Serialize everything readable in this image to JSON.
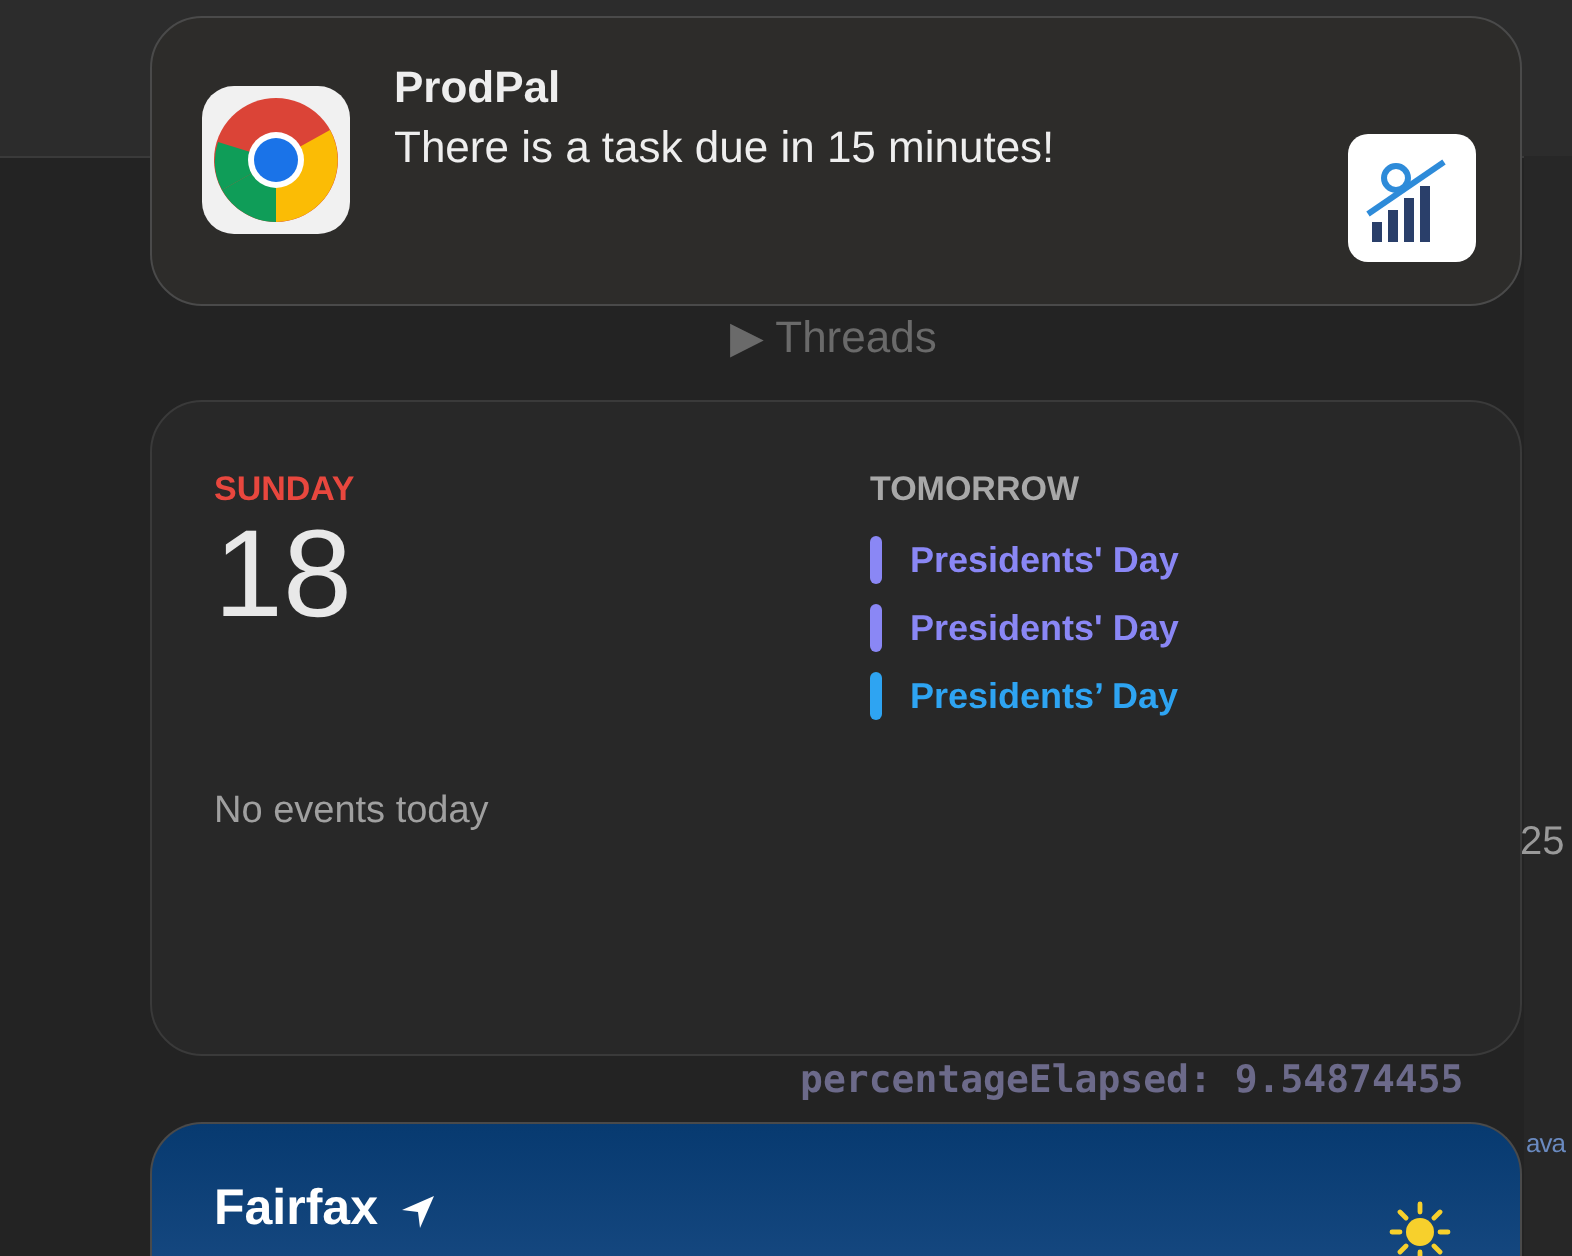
{
  "background": {
    "threads_label": "Threads",
    "threads_arrow": "▶",
    "number_fragment": "25",
    "code_line": "percentageElapsed: 9.54874455",
    "code_fragment": "ava"
  },
  "notification": {
    "app": "ProdPal",
    "message": "There is a task due in 15 minutes!"
  },
  "calendar": {
    "weekday": "SUNDAY",
    "day": "18",
    "empty": "No events today",
    "upcoming_heading": "TOMORROW",
    "events": [
      {
        "title": "Presidents' Day",
        "color": "#8a87f5"
      },
      {
        "title": "Presidents' Day",
        "color": "#8a87f5"
      },
      {
        "title": "Presidents’ Day",
        "color": "#2ea4f2"
      }
    ]
  },
  "weather": {
    "city": "Fairfax"
  }
}
